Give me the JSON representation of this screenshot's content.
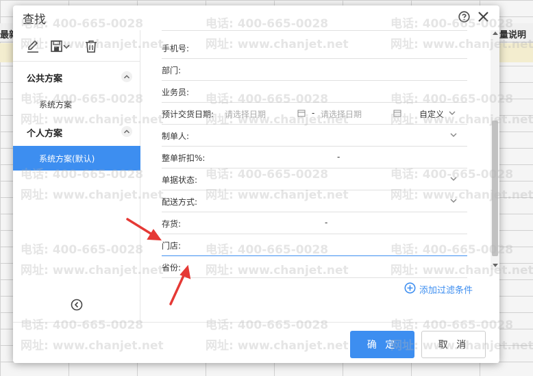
{
  "background": {
    "left_header": "最新",
    "right_header": "量说明"
  },
  "dialog": {
    "title": "查找",
    "help_icon": "help-circle-icon",
    "close_icon": "close-icon"
  },
  "left_panel": {
    "toolbar": [
      {
        "icon": "edit-icon"
      },
      {
        "icon": "save-icon"
      },
      {
        "icon": "trash-icon"
      }
    ],
    "groups": [
      {
        "label": "公共方案",
        "items": [
          {
            "label": "系统方案",
            "active": false
          }
        ]
      },
      {
        "label": "个人方案",
        "items": [
          {
            "label": "系统方案(默认)",
            "active": true
          }
        ]
      }
    ],
    "collapse_icon": "chevron-left-circle-icon"
  },
  "fields": [
    {
      "label": "手机号:"
    },
    {
      "label": "部门:"
    },
    {
      "label": "业务员:"
    },
    {
      "label": "预计交货日期:",
      "start_placeholder": "请选择日期",
      "separator": "-",
      "end_placeholder": "请选择日期",
      "range_option": "自定义"
    },
    {
      "label": "制单人:"
    },
    {
      "label": "整单折扣%:",
      "separator": "-"
    },
    {
      "label": "单据状态:"
    },
    {
      "label": "配送方式:"
    },
    {
      "label": "存货:",
      "separator": "-"
    },
    {
      "label": "门店:"
    },
    {
      "label": "省份:"
    }
  ],
  "add_filter": {
    "label": "添加过滤条件"
  },
  "footer": {
    "ok_label": "确 定",
    "cancel_label": "取 消"
  },
  "watermark": {
    "phone": "电话: 400-665-0028",
    "site": "网址: www.chanjet.net"
  },
  "colors": {
    "accent": "#3d8ef0",
    "arrow": "#e53935"
  }
}
